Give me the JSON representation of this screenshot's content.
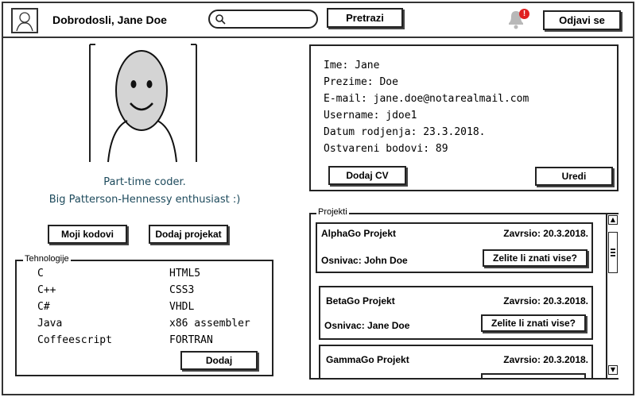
{
  "header": {
    "welcome": "Dobrodosli, Jane Doe",
    "search_placeholder": "",
    "search_button": "Pretrazi",
    "notification_count": "!",
    "logout_button": "Odjavi se"
  },
  "profile": {
    "bio_line1": "Part-time coder.",
    "bio_line2": "Big Patterson-Hennessy enthusiast :)",
    "my_codes_button": "Moji kodovi",
    "add_project_button": "Dodaj projekat"
  },
  "technologies": {
    "legend": "Tehnologije",
    "col1": [
      "C",
      "C++",
      "C#",
      "Java",
      "Coffeescript"
    ],
    "col2": [
      "HTML5",
      "CSS3",
      "VHDL",
      "x86 assembler",
      "FORTRAN"
    ],
    "add_button": "Dodaj"
  },
  "info": {
    "lines": [
      "Ime: Jane",
      "Prezime: Doe",
      "E-mail: jane.doe@notarealmail.com",
      "Username: jdoe1",
      "Datum rodjenja: 23.3.2018.",
      "Ostvareni bodovi: 89"
    ],
    "add_cv_button": "Dodaj CV",
    "edit_button": "Uredi"
  },
  "projects": {
    "legend": "Projekti",
    "items": [
      {
        "name": "AlphaGo Projekt",
        "finished": "Zavrsio: 20.3.2018.",
        "founder": "Osnivac: John Doe",
        "more": "Zelite li znati vise?"
      },
      {
        "name": "BetaGo Projekt",
        "finished": "Zavrsio: 20.3.2018.",
        "founder": "Osnivac: Jane Doe",
        "more": "Zelite li znati vise?"
      },
      {
        "name": "GammaGo Projekt",
        "finished": "Zavrsio: 20.3.2018.",
        "founder": "",
        "more": ""
      }
    ]
  }
}
